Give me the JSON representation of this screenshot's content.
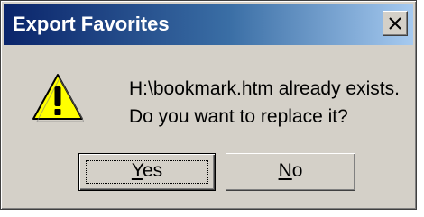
{
  "window": {
    "title": "Export Favorites",
    "close_icon": "close-icon"
  },
  "message": {
    "icon": "warning-icon",
    "line1": "H:\\bookmark.htm already exists.",
    "line2": "Do you want to replace it?"
  },
  "buttons": {
    "yes": {
      "mnemonic": "Y",
      "rest": "es"
    },
    "no": {
      "mnemonic": "N",
      "rest": "o"
    }
  },
  "colors": {
    "titlebar_start": "#0a246a",
    "titlebar_end": "#a6caf0",
    "dialog_face": "#d4d0c8",
    "warning_fill": "#ffff00"
  }
}
